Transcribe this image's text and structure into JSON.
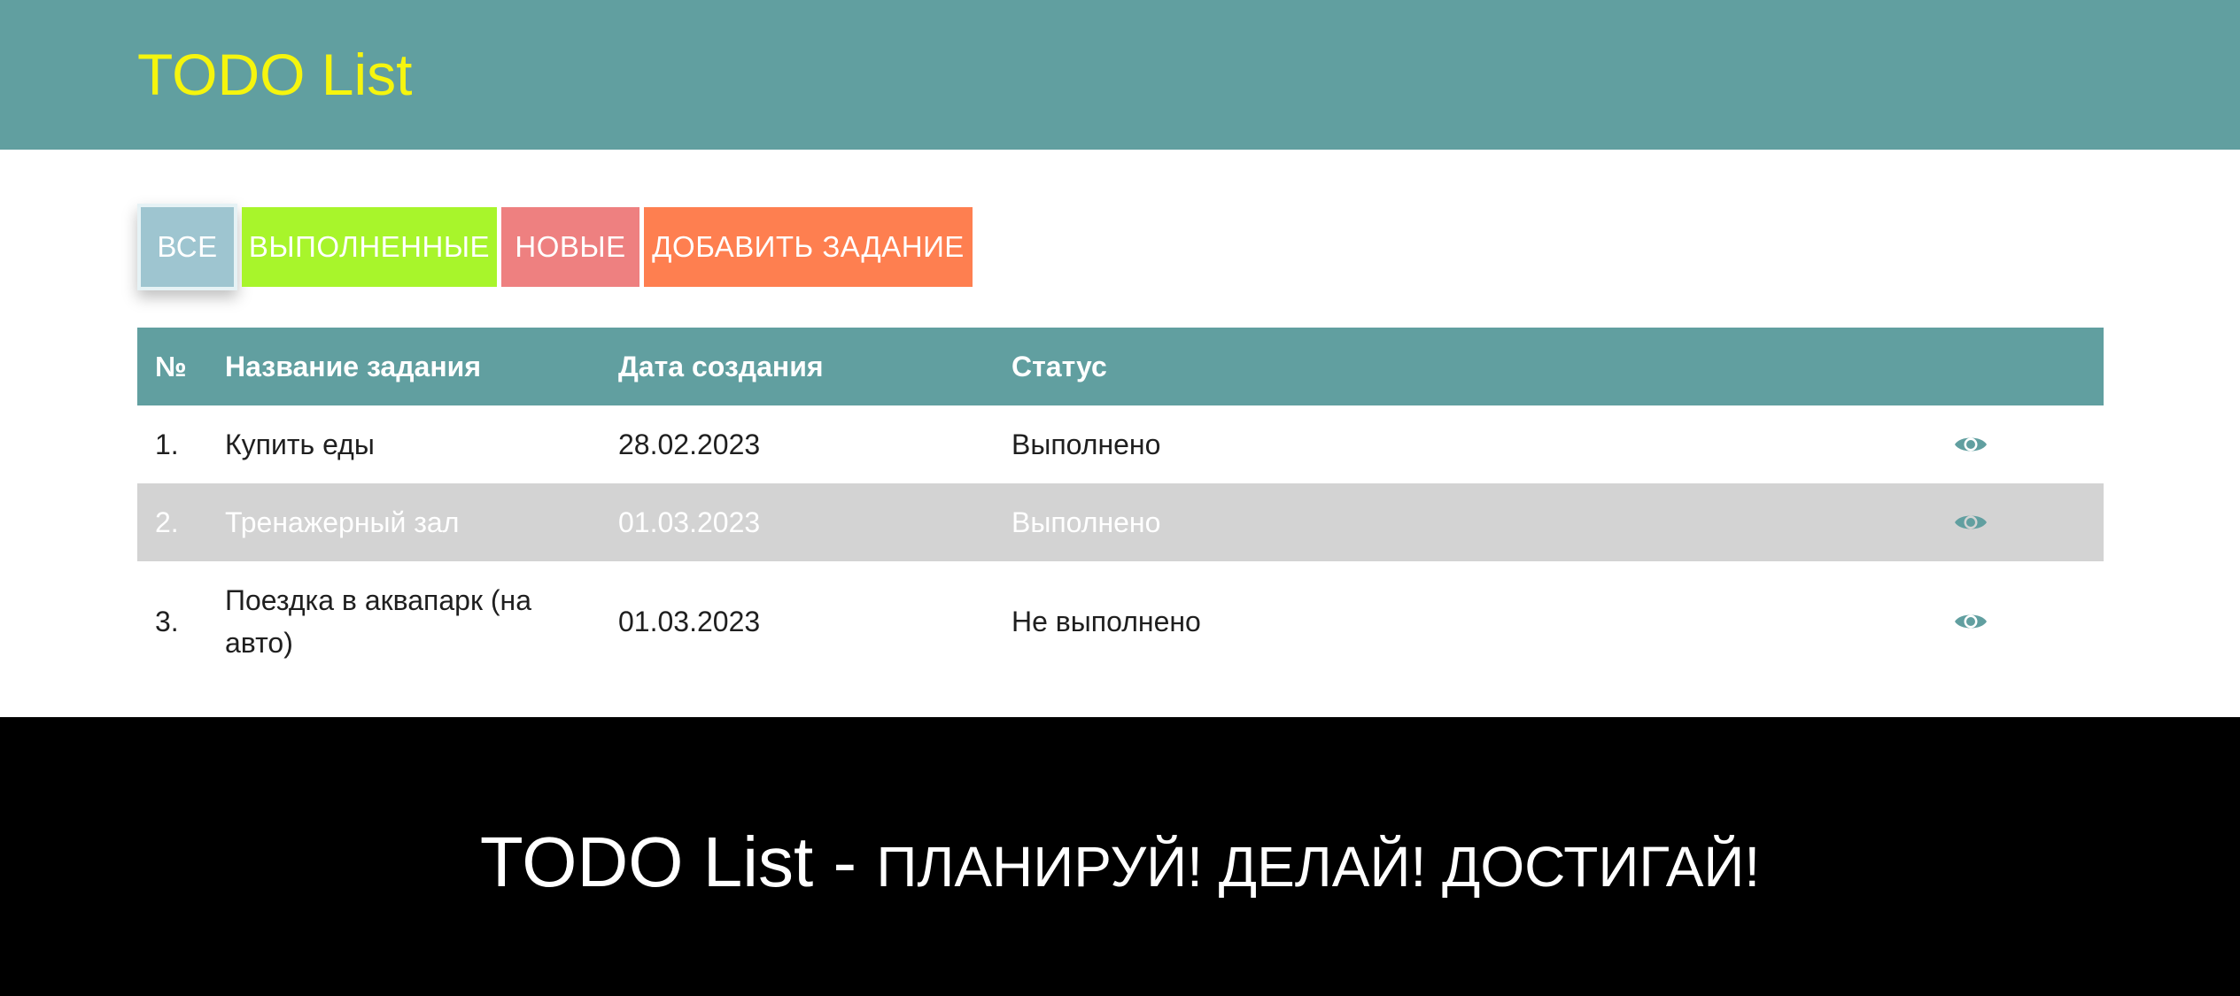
{
  "header": {
    "title": "TODO List"
  },
  "filters": {
    "all": "ВСЕ",
    "done": "ВЫПОЛНЕННЫЕ",
    "new": "НОВЫЕ",
    "add": "ДОБАВИТЬ ЗАДАНИЕ"
  },
  "table": {
    "headers": {
      "num": "№",
      "name": "Название задания",
      "date": "Дата создания",
      "status": "Статус"
    },
    "rows": [
      {
        "num": "1.",
        "name": "Купить еды",
        "date": "28.02.2023",
        "status": "Выполнено",
        "action_icon": "eye-icon"
      },
      {
        "num": "2.",
        "name": "Тренажерный зал",
        "date": "01.03.2023",
        "status": "Выполнено",
        "action_icon": "eye-icon"
      },
      {
        "num": "3.",
        "name": "Поездка в аквапарк (на авто)",
        "date": "01.03.2023",
        "status": "Не выполнено",
        "action_icon": "eye-icon"
      }
    ]
  },
  "footer": {
    "app_name": "TODO List",
    "separator": " - ",
    "slogan": "ПЛАНИРУЙ! ДЕЛАЙ! ДОСТИГАЙ!"
  },
  "colors": {
    "header_bg": "#619fa0",
    "title": "#f5f50e",
    "all_btn": "#9ec5d0",
    "done_btn": "#a8f52b",
    "new_btn": "#ee8080",
    "add_btn": "#fe7f50",
    "alt_row": "#d3d3d3",
    "eye_icon": "#619fa0",
    "footer_bg": "#000000"
  }
}
